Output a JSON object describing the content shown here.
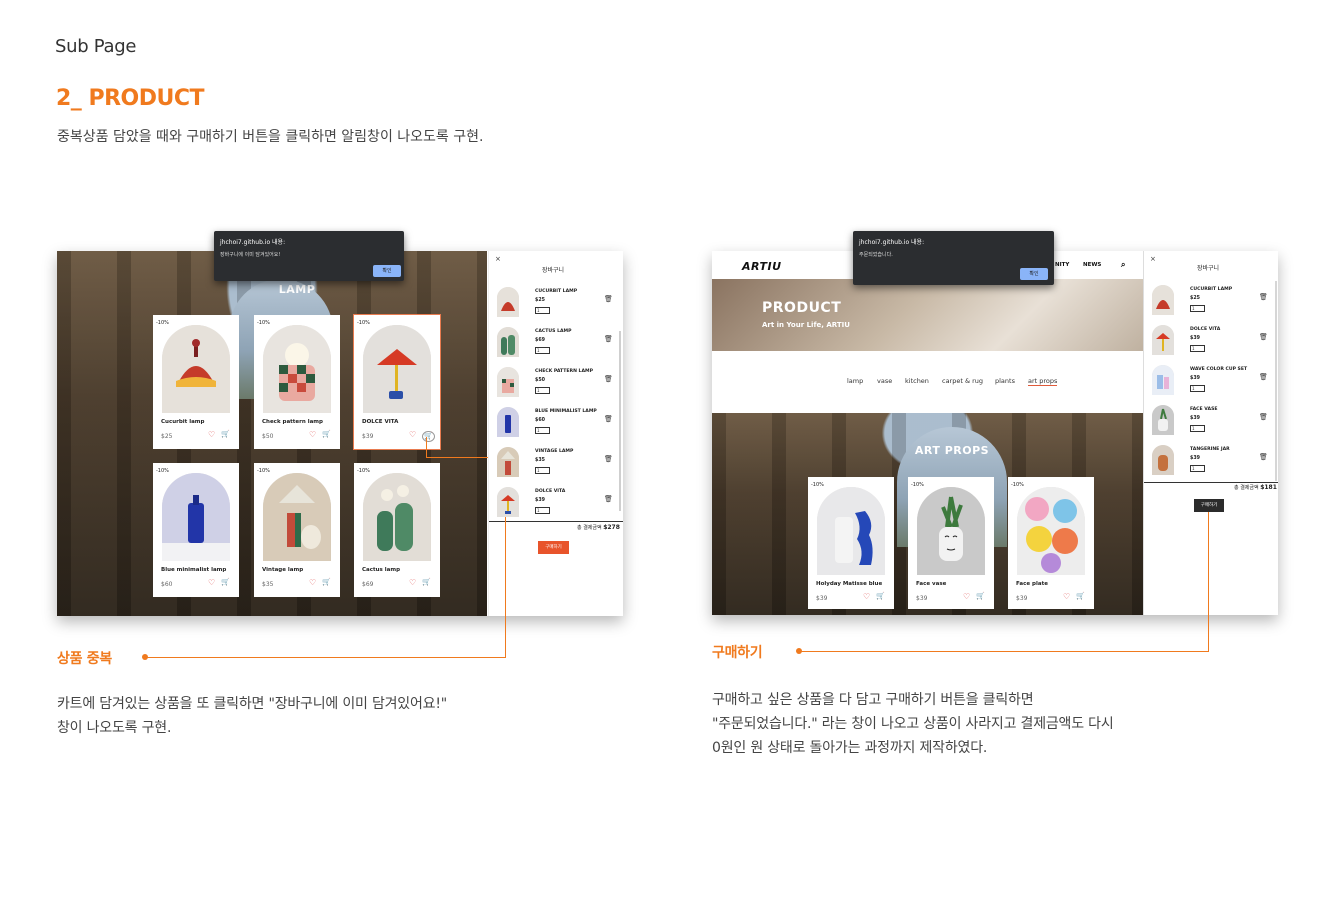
{
  "header": {
    "sub_page": "Sub Page",
    "section_title": "2_ PRODUCT",
    "section_desc": "중복상품 담았을 때와 구매하기 버튼을 클릭하면 알림창이 나오도록 구현."
  },
  "left_shot": {
    "banner_label": "LAMP",
    "alert": {
      "title": "jhchoi7.github.io 내용:",
      "message": "장바구니에 이미 담겨있어요!",
      "ok": "확인"
    },
    "products": [
      {
        "badge": "-10%",
        "name": "Cucurbit lamp",
        "price": "$25"
      },
      {
        "badge": "-10%",
        "name": "Check pattern lamp",
        "price": "$50"
      },
      {
        "badge": "-10%",
        "name": "DOLCE VITA",
        "price": "$39"
      },
      {
        "badge": "-10%",
        "name": "Blue minimalist lamp",
        "price": "$60"
      },
      {
        "badge": "-10%",
        "name": "Vintage lamp",
        "price": "$35"
      },
      {
        "badge": "-10%",
        "name": "Cactus lamp",
        "price": "$69"
      }
    ],
    "cart": {
      "close": "×",
      "title": "장바구니",
      "items": [
        {
          "name": "CUCURBIT LAMP",
          "price": "$25",
          "qty": "1"
        },
        {
          "name": "CACTUS LAMP",
          "price": "$69",
          "qty": "1"
        },
        {
          "name": "CHECK PATTERN LAMP",
          "price": "$50",
          "qty": "1"
        },
        {
          "name": "BLUE MINIMALIST LAMP",
          "price": "$60",
          "qty": "1"
        },
        {
          "name": "VINTAGE LAMP",
          "price": "$35",
          "qty": "1"
        },
        {
          "name": "DOLCE VITA",
          "price": "$39",
          "qty": "1"
        }
      ],
      "total_label": "총 결제금액",
      "total_value": "$278",
      "buy": "구매하기"
    }
  },
  "right_shot": {
    "logo": "ARTIU",
    "nav": [
      "NITY",
      "NEWS"
    ],
    "hero_title": "PRODUCT",
    "hero_sub": "Art in Your Life, ARTIU",
    "categories": [
      "lamp",
      "vase",
      "kitchen",
      "carpet & rug",
      "plants",
      "art props"
    ],
    "banner_label": "ART PROPS",
    "alert": {
      "title": "jhchoi7.github.io 내용:",
      "message": "주문되었습니다.",
      "ok": "확인"
    },
    "products": [
      {
        "badge": "-10%",
        "name": "Holyday Matisse blue",
        "price": "$39"
      },
      {
        "badge": "-10%",
        "name": "Face vase",
        "price": "$39"
      },
      {
        "badge": "-10%",
        "name": "Face plate",
        "price": "$39"
      }
    ],
    "cart": {
      "close": "×",
      "title": "장바구니",
      "items": [
        {
          "name": "CUCURBIT LAMP",
          "price": "$25",
          "qty": "1"
        },
        {
          "name": "DOLCE VITA",
          "price": "$39",
          "qty": "1"
        },
        {
          "name": "WAVE COLOR CUP SET",
          "price": "$39",
          "qty": "1"
        },
        {
          "name": "FACE VASE",
          "price": "$39",
          "qty": "1"
        },
        {
          "name": "TANGERINE JAR",
          "price": "$39",
          "qty": "1"
        }
      ],
      "total_label": "총 결제금액",
      "total_value": "$181",
      "buy": "구매하기"
    }
  },
  "annotations": {
    "left_label": "상품 중복",
    "left_desc_1": "카트에 담겨있는 상품을 또 클릭하면 \"장바구니에 이미 담겨있어요!\"",
    "left_desc_2": "창이 나오도록 구현.",
    "right_label": "구매하기",
    "right_desc_1": "구매하고 싶은 상품을 다 담고 구매하기 버튼을 클릭하면",
    "right_desc_2": "\"주문되었습니다.\" 라는 창이 나오고 상품이 사라지고 결제금액도 다시",
    "right_desc_3": "0원인 원 상태로 돌아가는 과정까지 제작하였다."
  },
  "colors": {
    "accent": "#f07a1e",
    "buy_button_left": "#e8542b",
    "buy_button_right": "#2b2b2b",
    "alert_bg": "#2b2d30",
    "alert_ok": "#8ab4f8"
  }
}
